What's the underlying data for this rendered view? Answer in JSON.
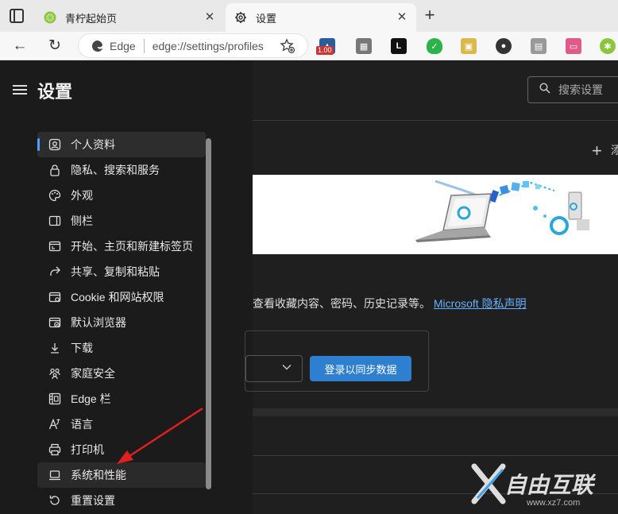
{
  "browser": {
    "tabs": [
      {
        "title": "青柠起始页",
        "active": false
      },
      {
        "title": "设置",
        "active": true
      }
    ],
    "address": {
      "site_label": "Edge",
      "url": "edge://settings/profiles"
    },
    "extension_badge": "1.00"
  },
  "settings": {
    "title": "设置",
    "search_placeholder": "搜索设置",
    "nav": [
      {
        "label": "个人资料",
        "icon": "profile-icon",
        "state": "selected"
      },
      {
        "label": "隐私、搜索和服务",
        "icon": "lock-icon"
      },
      {
        "label": "外观",
        "icon": "palette-icon"
      },
      {
        "label": "侧栏",
        "icon": "sidebar-icon"
      },
      {
        "label": "开始、主页和新建标签页",
        "icon": "home-tab-icon"
      },
      {
        "label": "共享、复制和粘贴",
        "icon": "share-icon"
      },
      {
        "label": "Cookie 和网站权限",
        "icon": "cookie-icon"
      },
      {
        "label": "默认浏览器",
        "icon": "browser-icon"
      },
      {
        "label": "下载",
        "icon": "download-icon"
      },
      {
        "label": "家庭安全",
        "icon": "family-icon"
      },
      {
        "label": "Edge 栏",
        "icon": "edge-bar-icon"
      },
      {
        "label": "语言",
        "icon": "language-icon"
      },
      {
        "label": "打印机",
        "icon": "printer-icon"
      },
      {
        "label": "系统和性能",
        "icon": "laptop-icon",
        "state": "hover"
      },
      {
        "label": "重置设置",
        "icon": "reset-icon"
      }
    ]
  },
  "main": {
    "add_profile_partial": "添",
    "sync_text": "查看收藏内容、密码、历史记录等。",
    "privacy_link": "Microsoft 隐私声明",
    "signin_button": "登录以同步数据"
  },
  "watermark": {
    "text": "自由互联",
    "url": "www.xz7.com"
  },
  "colors": {
    "accent": "#4aa3ff",
    "signin": "#2f7fd0",
    "arrow": "#e02020"
  }
}
